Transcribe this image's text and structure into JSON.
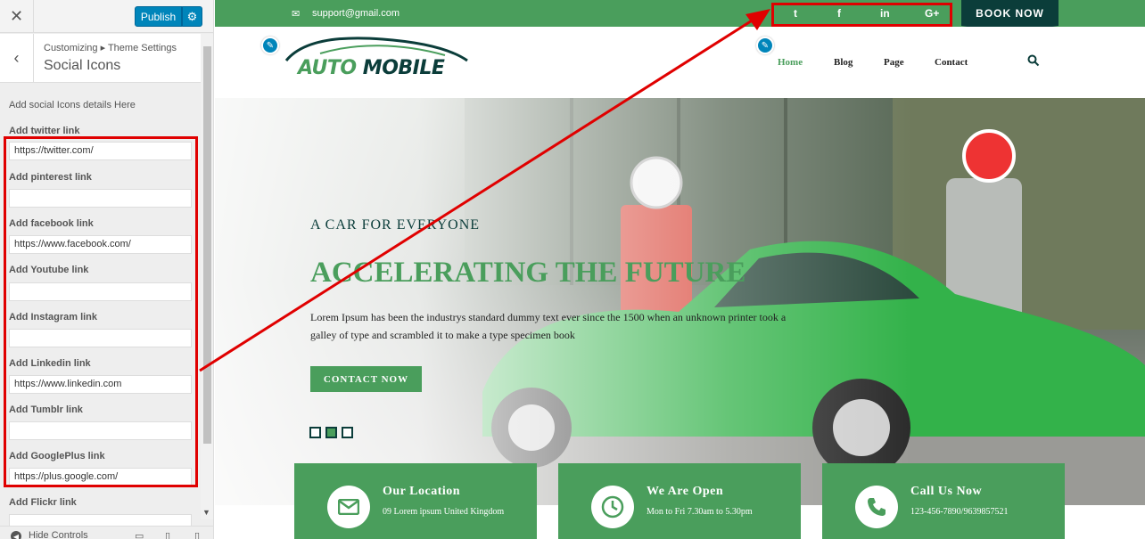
{
  "sidebar": {
    "close_icon": "✕",
    "publish_label": "Publish",
    "gear_icon": "⚙",
    "back_icon": "‹",
    "breadcrumb": "Customizing ▸ Theme Settings",
    "section_title": "Social Icons",
    "description": "Add social Icons details Here",
    "fields": [
      {
        "label": "Add twitter link",
        "value": "https://twitter.com/"
      },
      {
        "label": "Add pinterest link",
        "value": ""
      },
      {
        "label": "Add facebook link",
        "value": "https://www.facebook.com/"
      },
      {
        "label": "Add Youtube link",
        "value": ""
      },
      {
        "label": "Add Instagram link",
        "value": ""
      },
      {
        "label": "Add Linkedin link",
        "value": "https://www.linkedin.com"
      },
      {
        "label": "Add Tumblr link",
        "value": ""
      },
      {
        "label": "Add GooglePlus link",
        "value": "https://plus.google.com/"
      },
      {
        "label": "Add Flickr link",
        "value": ""
      }
    ],
    "hide_controls_label": "Hide Controls"
  },
  "topbar": {
    "email": "support@gmail.com",
    "social": {
      "twitter": "t",
      "facebook": "f",
      "linkedin": "in",
      "googleplus": "G+"
    },
    "book_now": "BOOK NOW"
  },
  "header": {
    "logo_part1": "AUTO",
    "logo_part2": "MOBILE",
    "nav": [
      "Home",
      "Blog",
      "Page",
      "Contact"
    ]
  },
  "hero": {
    "subtitle": "A CAR FOR EVERYONE",
    "title": "ACCELERATING THE FUTURE",
    "text": "Lorem Ipsum has been the industrys standard dummy text ever since the 1500 when an unknown printer took a galley of type and scrambled it to make a type specimen book",
    "button": "CONTACT NOW"
  },
  "info": [
    {
      "title": "Our Location",
      "text": "09 Lorem ipsum United Kingdom",
      "icon": "mail-icon"
    },
    {
      "title": "We Are Open",
      "text": "Mon to Fri 7.30am to 5.30pm",
      "icon": "clock-icon"
    },
    {
      "title": "Call Us Now",
      "text": "123-456-7890/9639857521",
      "icon": "phone-icon"
    }
  ],
  "colors": {
    "brand_green": "#4a9e5c",
    "dark_teal": "#0b3d3a",
    "wp_blue": "#0085ba",
    "annotation_red": "#e00000"
  }
}
